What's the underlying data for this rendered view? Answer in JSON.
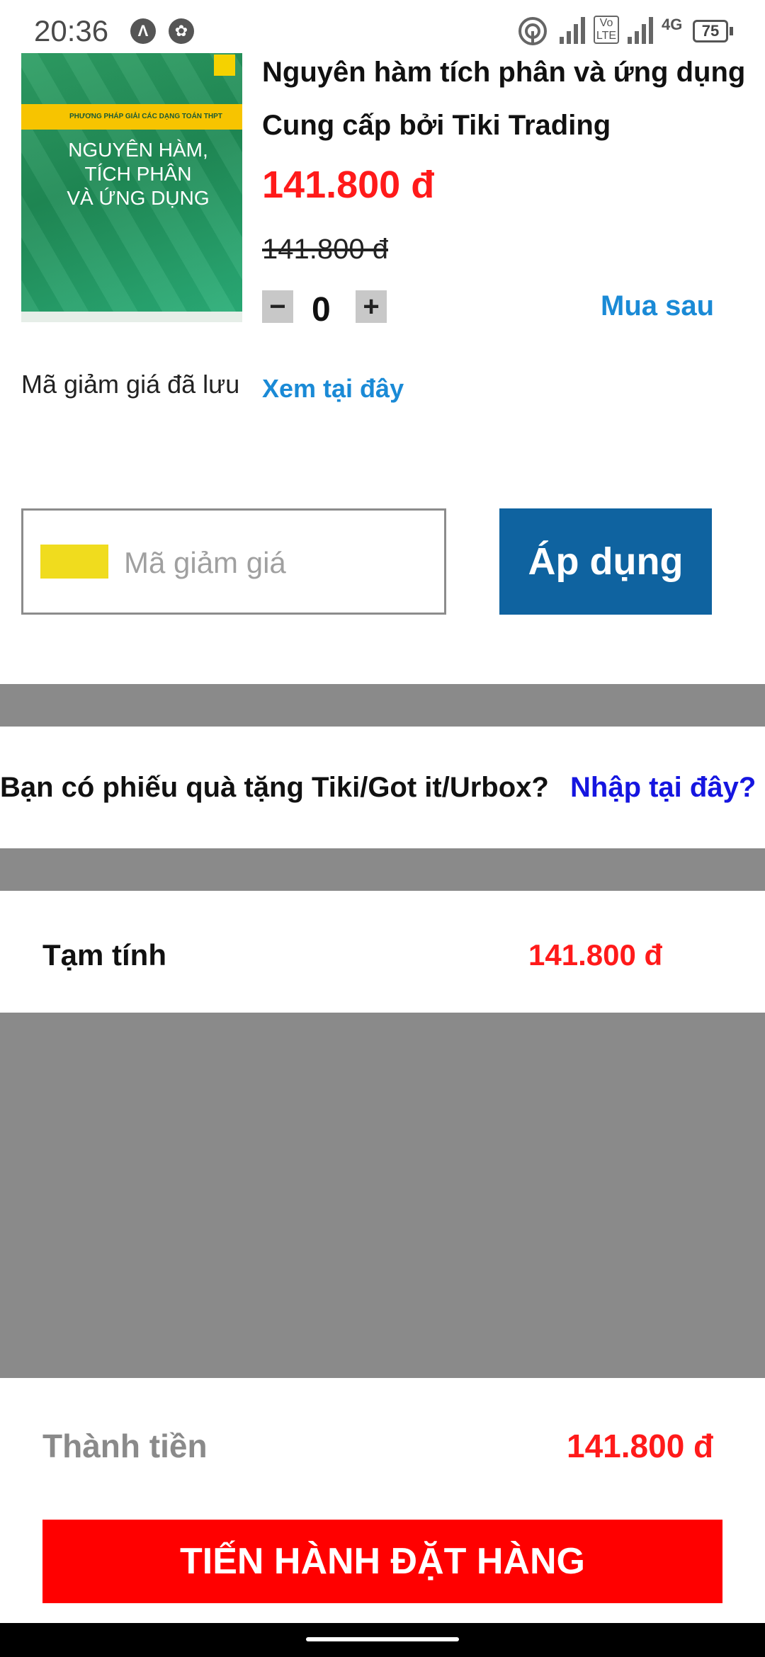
{
  "status_bar": {
    "time": "20:36",
    "battery": "75",
    "network": "4G",
    "volte": "Vo LTE"
  },
  "product": {
    "title": "Nguyên hàm tích phân và ứng dụng",
    "provider": "Cung cấp bởi Tiki Trading",
    "price": "141.800 đ",
    "old_price": "141.800 đ",
    "quantity": "0",
    "buy_later_label": "Mua sau",
    "cover": {
      "banner": "PHƯƠNG PHÁP GIẢI CÁC DẠNG TOÁN THPT",
      "title_line1": "NGUYÊN HÀM,",
      "title_line2": "TÍCH PHÂN",
      "title_line3": "VÀ ỨNG DỤNG"
    }
  },
  "saved_coupon": {
    "label": "Mã giảm giá đã lưu",
    "link": "Xem tại đây"
  },
  "coupon": {
    "placeholder": "Mã giảm giá",
    "apply_label": "Áp dụng"
  },
  "gift": {
    "question": "Bạn có phiếu quà tặng Tiki/Got it/Urbox?",
    "link": "Nhập tại đây?"
  },
  "summary": {
    "subtotal_label": "Tạm tính",
    "subtotal_value": "141.800 đ",
    "total_label": "Thành tiền",
    "total_value": "141.800 đ"
  },
  "checkout": {
    "label": "TIẾN HÀNH ĐẶT HÀNG"
  },
  "colors": {
    "price_red": "#ff1a1a",
    "link_blue": "#1a8ad6",
    "apply_blue": "#0f63a0",
    "checkout_red": "#ff0000",
    "band_gray": "#8a8a8a"
  }
}
